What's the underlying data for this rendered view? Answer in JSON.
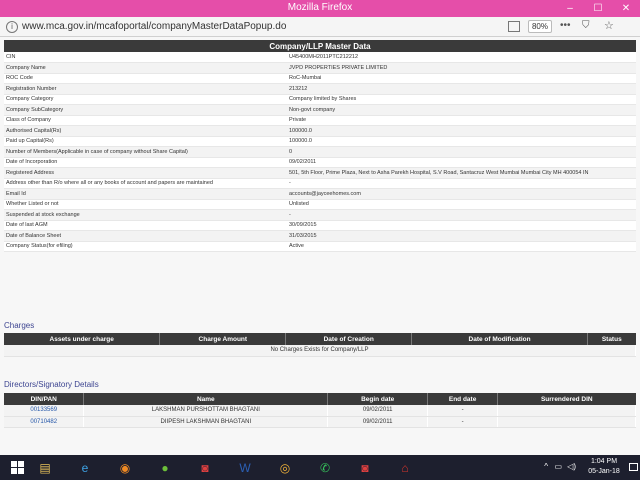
{
  "window": {
    "title": "Mozilla Firefox",
    "minimize": "–",
    "maximize": "☐",
    "close": "✕"
  },
  "browser": {
    "url": "www.mca.gov.in/mcafoportal/companyMasterDataPopup.do",
    "zoom": "80%",
    "more_glyph": "•••",
    "shield_glyph": "⛉",
    "star_glyph": "☆",
    "info_glyph": "i"
  },
  "master_data": {
    "title": "Company/LLP Master Data",
    "rows": [
      {
        "label": "CIN",
        "value": "U45400MH2011PTC212212"
      },
      {
        "label": "Company Name",
        "value": "JVPD PROPERTIES PRIVATE LIMITED"
      },
      {
        "label": "ROC Code",
        "value": "RoC-Mumbai"
      },
      {
        "label": "Registration Number",
        "value": "213212"
      },
      {
        "label": "Company Category",
        "value": "Company limited by Shares"
      },
      {
        "label": "Company SubCategory",
        "value": "Non-govt company"
      },
      {
        "label": "Class of Company",
        "value": "Private"
      },
      {
        "label": "Authorised Capital(Rs)",
        "value": "100000.0"
      },
      {
        "label": "Paid up Capital(Rs)",
        "value": "100000.0"
      },
      {
        "label": "Number of Members(Applicable in case of company without Share Capital)",
        "value": "0"
      },
      {
        "label": "Date of Incorporation",
        "value": "09/02/2011"
      },
      {
        "label": "Registered Address",
        "value": "501, 5th Floor, Prime Plaza, Next to Asha Parekh Hospital, S.V Road, Santacruz West Mumbai Mumbai City MH 400054 IN"
      },
      {
        "label": "Address other than R/o where all or any books of account and papers are maintained",
        "value": "-"
      },
      {
        "label": "Email Id",
        "value": "accounts@jayceehomes.com"
      },
      {
        "label": "Whether Listed or not",
        "value": "Unlisted"
      },
      {
        "label": "Suspended at stock exchange",
        "value": "-"
      },
      {
        "label": "Date of last AGM",
        "value": "30/09/2015"
      },
      {
        "label": "Date of Balance Sheet",
        "value": "31/03/2015"
      },
      {
        "label": "Company Status(for efiling)",
        "value": "Active"
      }
    ]
  },
  "charges": {
    "title": "Charges",
    "headers": [
      "Assets under charge",
      "Charge Amount",
      "Date of Creation",
      "Date of Modification",
      "Status"
    ],
    "empty_message": "No Charges Exists for Company/LLP"
  },
  "directors": {
    "title": "Directors/Signatory Details",
    "headers": [
      "DIN/PAN",
      "Name",
      "Begin date",
      "End date",
      "Surrendered DIN"
    ],
    "rows": [
      {
        "din": "00133569",
        "name": "LAKSHMAN PURSHOTTAM BHAGTANI",
        "begin": "09/02/2011",
        "end": "-",
        "surrendered": ""
      },
      {
        "din": "00710482",
        "name": "DIIPESH LAKSHMAN BHAGTANI",
        "begin": "09/02/2011",
        "end": "-",
        "surrendered": ""
      }
    ]
  },
  "taskbar": {
    "time": "1:04 PM",
    "date": "05-Jan-18",
    "tray_up": "^",
    "tray_net": "▭",
    "tray_vol": "◁)",
    "apps": [
      {
        "name": "file-explorer-icon",
        "glyph": "▤",
        "color": "#e8c25a"
      },
      {
        "name": "internet-explorer-icon",
        "glyph": "e",
        "color": "#3ea3e6"
      },
      {
        "name": "firefox-icon",
        "glyph": "◉",
        "color": "#f08a24"
      },
      {
        "name": "green-app-icon",
        "glyph": "●",
        "color": "#6cbf3a"
      },
      {
        "name": "camera-app-icon",
        "glyph": "◙",
        "color": "#e04040"
      },
      {
        "name": "word-icon",
        "glyph": "W",
        "color": "#2b5fb4"
      },
      {
        "name": "chrome-icon",
        "glyph": "◎",
        "color": "#f2b33a"
      },
      {
        "name": "whatsapp-icon",
        "glyph": "✆",
        "color": "#36c35b"
      },
      {
        "name": "camera-app-2-icon",
        "glyph": "◙",
        "color": "#e04040"
      },
      {
        "name": "acrobat-icon",
        "glyph": "⌂",
        "color": "#d6342c"
      }
    ]
  }
}
